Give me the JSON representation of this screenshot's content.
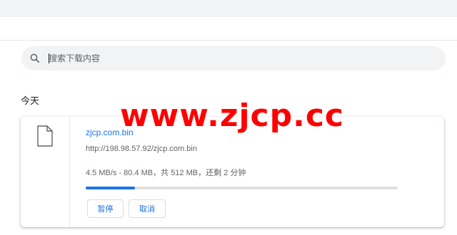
{
  "search": {
    "placeholder": "搜索下载内容",
    "icon": "search-icon"
  },
  "section": {
    "label": "今天"
  },
  "download": {
    "icon": "file-icon",
    "file_name": "zjcp.com.bin",
    "url": "http://198.98.57.92/zjcp.com.bin",
    "status": "4.5 MB/s - 80.4 MB，共 512 MB，还剩 2 分钟",
    "progress": 0.157,
    "pause_label": "暂停",
    "cancel_label": "取消"
  },
  "watermark": {
    "text": "www.zjcp.cc"
  },
  "colors": {
    "accent": "#1a73e8",
    "watermark": "#ff0000",
    "search_bg": "#f1f3f4"
  }
}
